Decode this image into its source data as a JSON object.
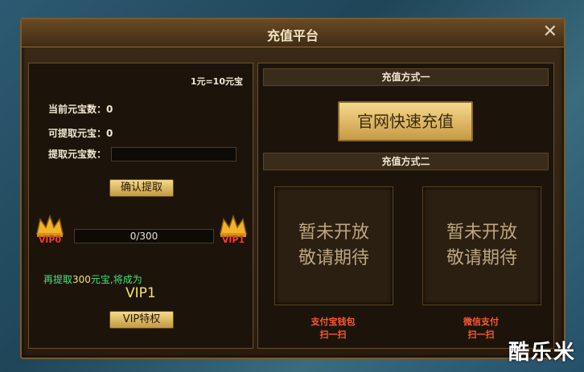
{
  "window": {
    "title": "充值平台",
    "close_glyph": "✕"
  },
  "left": {
    "rate": "1元=10元宝",
    "current_label": "当前元宝数：",
    "current_value": "0",
    "withdrawable_label": "可提取元宝：",
    "withdrawable_value": "0",
    "withdraw_label": "提取元宝数：",
    "withdraw_input_value": "",
    "confirm_button": "确认提取",
    "vip_from": "VIP0",
    "vip_to": "VIP1",
    "progress_text": "0/300",
    "progress_fraction": 0,
    "hint_prefix": "再提取",
    "hint_amount": "300",
    "hint_suffix": "元宝,将成为",
    "next_vip": "VIP1",
    "vip_button": "VIP特权"
  },
  "right": {
    "method1_title": "充值方式一",
    "official_button": "官网快速充值",
    "method2_title": "充值方式二",
    "alipay_line1": "暂未开放",
    "alipay_line2": "敬请期待",
    "alipay_caption1": "支付宝钱包",
    "alipay_caption2": "扫一扫",
    "wechat_line1": "暂未开放",
    "wechat_line2": "敬请期待",
    "wechat_caption1": "微信支付",
    "wechat_caption2": "扫一扫"
  },
  "watermark": "酷乐米",
  "colors": {
    "gold": "#f4e26a",
    "vip_red": "#ff3a2a",
    "hint_green": "#49e07a",
    "pay_red": "#ff5a32"
  },
  "icons": [
    "crown-icon",
    "close-icon"
  ]
}
